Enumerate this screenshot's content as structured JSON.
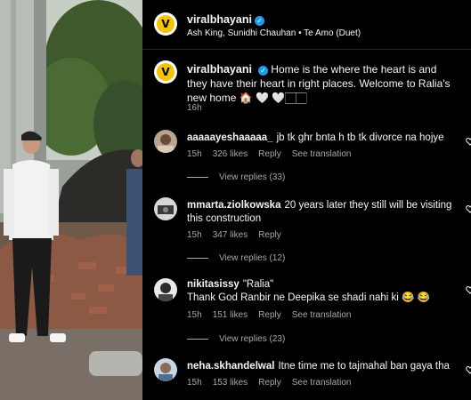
{
  "post": {
    "username": "viralbhayani",
    "audio": "Ash King, Sunidhi Chauhan • Te Amo (Duet)",
    "caption": "Home is the where the heart is and they have their heart in right places. Welcome to Ralia's new home 🏠 🤍 🤍🏻🏻",
    "time": "16h",
    "avatar_letter": "V"
  },
  "comments": [
    {
      "username": "aaaaayeshaaaaa_",
      "text": "jb tk ghr bnta h tb tk divorce na hojye",
      "time": "15h",
      "likes": "326 likes",
      "reply": "Reply",
      "translation": "See translation",
      "view_replies": "View replies (33)"
    },
    {
      "username": "mmarta.ziolkowska",
      "text": "20 years later they still will be visiting this construction",
      "time": "15h",
      "likes": "347 likes",
      "reply": "Reply",
      "translation": "",
      "view_replies": "View replies (12)"
    },
    {
      "username": "nikitasissy",
      "text": "\"Ralia\"",
      "text2": "Thank God Ranbir ne Deepika se shadi nahi ki 😂 😂",
      "time": "15h",
      "likes": "151 likes",
      "reply": "Reply",
      "translation": "See translation",
      "view_replies": "View replies (23)"
    },
    {
      "username": "neha.skhandelwal",
      "text": "Itne time me to tajmahal ban gaya tha",
      "time": "15h",
      "likes": "153 likes",
      "reply": "Reply",
      "translation": "See translation"
    }
  ],
  "colors": {
    "background": "#000000",
    "muted": "#a8a8a8",
    "verified": "#1d9bf0",
    "brand": "#f5c400"
  }
}
